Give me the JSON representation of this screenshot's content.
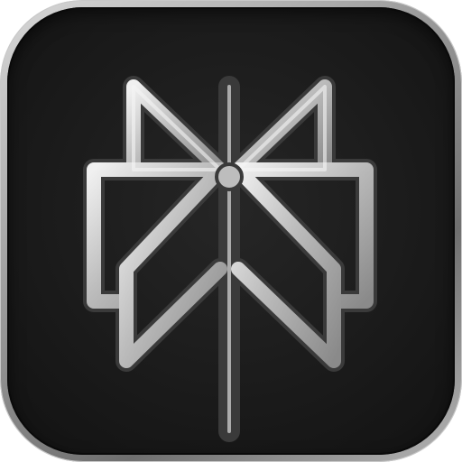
{
  "app_icon": {
    "icon_name": "geometric-star-logo-icon",
    "colors": {
      "frame_light": "#d9d9d9",
      "frame_dark": "#6f6f6f",
      "background": "#1b1b1b",
      "logo_stroke_light": "#e6e6e6",
      "logo_stroke_mid": "#a8a8a8",
      "logo_stroke_dark": "#5a5a5a"
    }
  }
}
